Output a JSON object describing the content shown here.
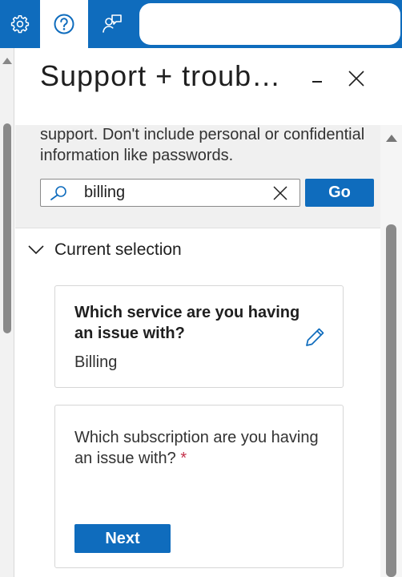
{
  "topbar": {
    "settings_icon": "gear-icon",
    "help_icon": "help-icon",
    "feedback_icon": "feedback-icon",
    "brand_color": "#0f6cbd"
  },
  "panel": {
    "title": "Support + troub…",
    "minimize_icon": "minimize-icon",
    "close_icon": "close-icon"
  },
  "info": {
    "text": "support. Don't include personal or confidential information like passwords."
  },
  "search": {
    "value": "billing",
    "go_label": "Go"
  },
  "current_selection": {
    "title": "Current selection",
    "questions": [
      {
        "question": "Which service are you having an issue with?",
        "answer": "Billing"
      },
      {
        "question": "Which subscription are you having an issue with?",
        "required_marker": "*",
        "button_label": "Next"
      }
    ]
  }
}
